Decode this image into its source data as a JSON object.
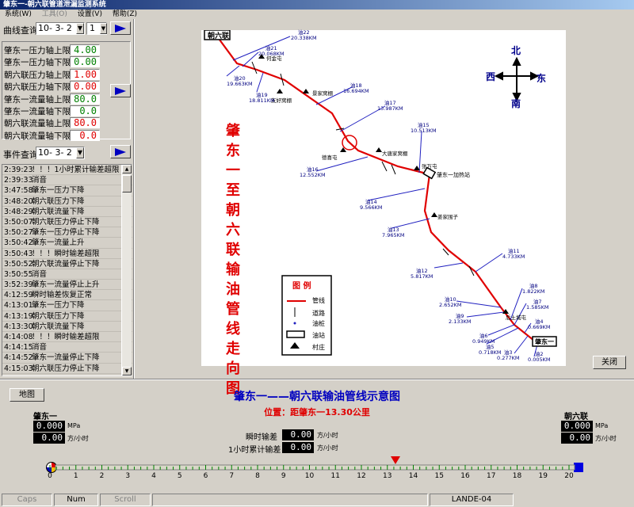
{
  "window": {
    "title": "肇东一-朝六联管道泄漏监测系统"
  },
  "menu": [
    {
      "label": "系统(W)",
      "enabled": true
    },
    {
      "label": "工具(O)",
      "enabled": false
    },
    {
      "label": "设置(V)",
      "enabled": true
    },
    {
      "label": "帮助(Z)",
      "enabled": true
    }
  ],
  "curve_query": {
    "label": "曲线查询",
    "date": "10- 3- 2",
    "index": "1"
  },
  "limits": [
    {
      "label": "肇东一压力轴上限",
      "value": "4.00",
      "color": "green"
    },
    {
      "label": "肇东一压力轴下限",
      "value": "0.00",
      "color": "green"
    },
    {
      "label": "朝六联压力轴上限",
      "value": "1.00",
      "color": "red"
    },
    {
      "label": "朝六联压力轴下限",
      "value": "0.00",
      "color": "red"
    },
    {
      "label": "肇东一流量轴上限",
      "value": "80.0",
      "color": "green"
    },
    {
      "label": "肇东一流量轴下限",
      "value": "0.0",
      "color": "green"
    },
    {
      "label": "朝六联流量轴上限",
      "value": "80.0",
      "color": "red"
    },
    {
      "label": "朝六联流量轴下限",
      "value": "0.0",
      "color": "red"
    }
  ],
  "event_query": {
    "label": "事件查询",
    "date": "10- 3- 2"
  },
  "events": [
    {
      "time": "2:39:23",
      "text": "！！！1小时累计输差超限"
    },
    {
      "time": "2:39:33",
      "text": "消音"
    },
    {
      "time": "3:47:58",
      "text": "肇东一压力下降"
    },
    {
      "time": "3:48:20",
      "text": "朝六联压力下降"
    },
    {
      "time": "3:48:29",
      "text": "朝六联流量下降"
    },
    {
      "time": "3:50:07",
      "text": "朝六联压力停止下降"
    },
    {
      "time": "3:50:27",
      "text": "肇东一压力停止下降"
    },
    {
      "time": "3:50:42",
      "text": "肇东一流量上升"
    },
    {
      "time": "3:50:43",
      "text": "！！！瞬时输差超限"
    },
    {
      "time": "3:50:52",
      "text": "朝六联流量停止下降"
    },
    {
      "time": "3:50:55",
      "text": "消音"
    },
    {
      "time": "3:52:39",
      "text": "肇东一流量停止上升"
    },
    {
      "time": "4:12:59",
      "text": "瞬时输差恢复正常"
    },
    {
      "time": "4:13:01",
      "text": "肇东一压力下降"
    },
    {
      "time": "4:13:19",
      "text": "朝六联压力下降"
    },
    {
      "time": "4:13:30",
      "text": "朝六联流量下降"
    },
    {
      "time": "4:14:08",
      "text": "！！！瞬时输差超限"
    },
    {
      "time": "4:14:15",
      "text": "消音"
    },
    {
      "time": "4:14:52",
      "text": "肇东一流量停止下降"
    },
    {
      "time": "4:15:03",
      "text": "朝六联压力停止下降"
    }
  ],
  "map": {
    "vertical_title": "肇东一至朝六联输油管线走向图",
    "compass": {
      "n": "北",
      "s": "南",
      "w": "西",
      "e": "东"
    },
    "stations": {
      "start": "朝六联",
      "end": "肇东一",
      "heat": "肇东一加热站"
    },
    "villages": [
      "何金屯",
      "景家窝棚",
      "友好窝棚",
      "德喜屯",
      "大唐家窝棚",
      "张万屯",
      "姜家围子",
      "后土城屯"
    ],
    "piles": [
      {
        "name": "油22",
        "km": "20.338KM"
      },
      {
        "name": "油21",
        "km": "20.068KM"
      },
      {
        "name": "油20",
        "km": "19.663KM"
      },
      {
        "name": "油19",
        "km": "18.811KM"
      },
      {
        "name": "油18",
        "km": "16.694KM"
      },
      {
        "name": "油17",
        "km": "13.987KM"
      },
      {
        "name": "油16",
        "km": "12.552KM"
      },
      {
        "name": "油15",
        "km": "10.513KM"
      },
      {
        "name": "油14",
        "km": "9.566KM"
      },
      {
        "name": "油13",
        "km": "7.965KM"
      },
      {
        "name": "油12",
        "km": "5.817KM"
      },
      {
        "name": "油11",
        "km": "4.733KM"
      },
      {
        "name": "油10",
        "km": "2.652KM"
      },
      {
        "name": "油9",
        "km": "2.133KM"
      },
      {
        "name": "油8",
        "km": "1.822KM"
      },
      {
        "name": "油7",
        "km": "1.585KM"
      },
      {
        "name": "油6",
        "km": "0.949KM"
      },
      {
        "name": "油5",
        "km": "0.718KM"
      },
      {
        "name": "油4",
        "km": "0.669KM"
      },
      {
        "name": "油3",
        "km": "0.277KM"
      },
      {
        "name": "油2",
        "km": "0.005KM"
      }
    ],
    "legend": {
      "title": "图 例",
      "items": [
        "管线",
        "道路",
        "油桩",
        "油站",
        "村庄"
      ]
    }
  },
  "close_button": "关闭",
  "map_button": "地图",
  "bottom": {
    "title": "肇东一——朝六联输油管线示意图",
    "position": "位置：距肇东一13.30公里",
    "left_station": {
      "name": "肇东一",
      "pressure": "0.000",
      "pressure_unit": "MPa",
      "flow": "0.00",
      "flow_unit": "方/小时"
    },
    "right_station": {
      "name": "朝六联",
      "pressure": "0.000",
      "pressure_unit": "MPa",
      "flow": "0.00",
      "flow_unit": "方/小时"
    },
    "instant_diff": {
      "label": "瞬时输差",
      "value": "0.00",
      "unit": "方/小时"
    },
    "hour_diff": {
      "label": "1小时累计输差",
      "value": "0.00",
      "unit": "方/小时"
    },
    "scale_labels": [
      "0",
      "1",
      "2",
      "3",
      "4",
      "5",
      "6",
      "7",
      "8",
      "9",
      "10",
      "11",
      "12",
      "13",
      "14",
      "15",
      "16",
      "17",
      "18",
      "19",
      "20"
    ],
    "marker_km": 13.3
  },
  "status": [
    "Caps",
    "Num",
    "Scroll",
    "",
    "LANDE-04"
  ]
}
